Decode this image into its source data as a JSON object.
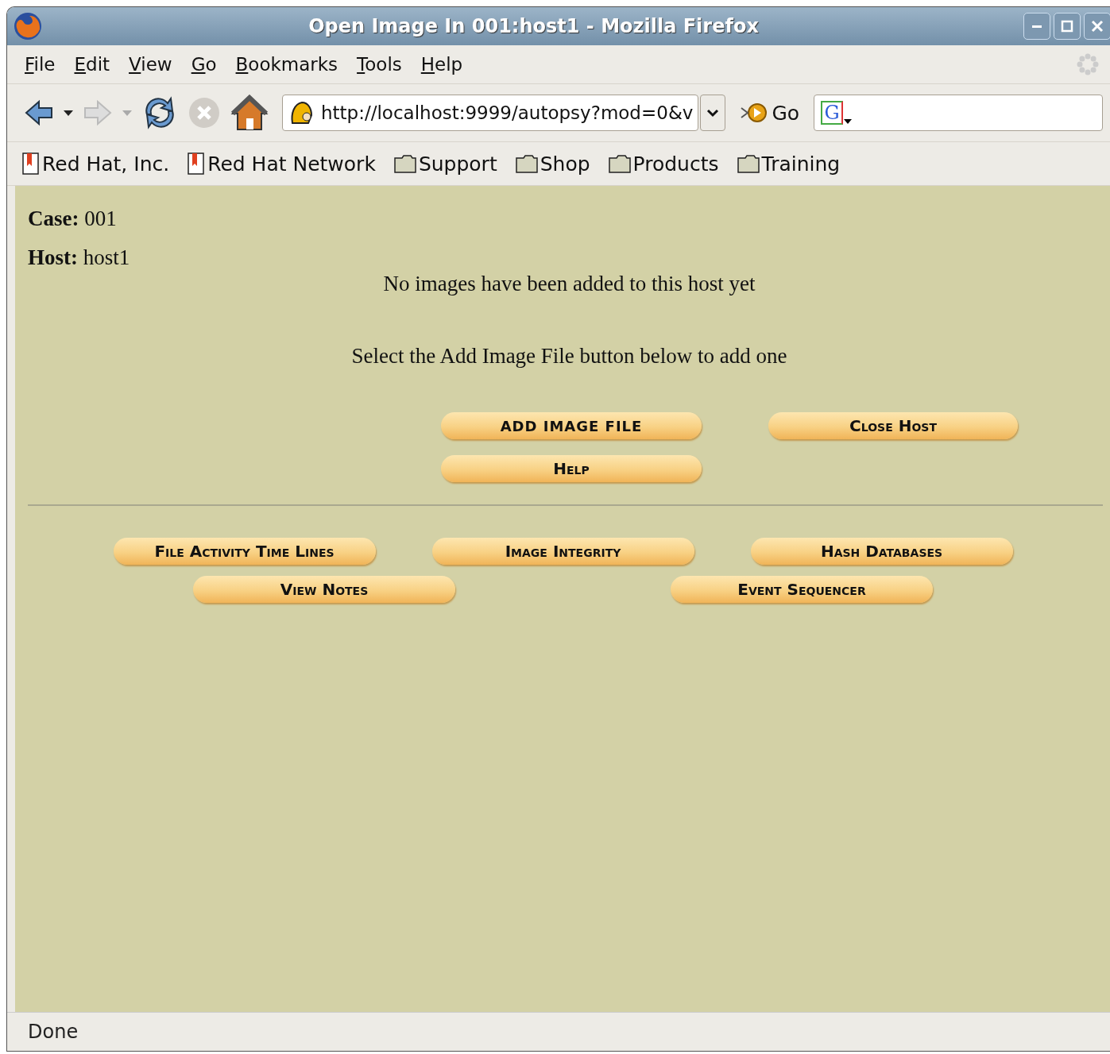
{
  "window": {
    "title": "Open Image In 001:host1 - Mozilla Firefox"
  },
  "menu": [
    "File",
    "Edit",
    "View",
    "Go",
    "Bookmarks",
    "Tools",
    "Help"
  ],
  "nav_buttons": [
    {
      "kind": "back",
      "disabled": false
    },
    {
      "kind": "forward",
      "disabled": true
    },
    {
      "kind": "reload",
      "disabled": false
    },
    {
      "kind": "stop",
      "disabled": true
    },
    {
      "kind": "home",
      "disabled": false
    }
  ],
  "address": {
    "value": "http://localhost:9999/autopsy?mod=0&v"
  },
  "go_button": {
    "label": "Go"
  },
  "search_field": {
    "engine_letter": "G"
  },
  "bookmarks": [
    {
      "label": "Red Hat, Inc.",
      "kind": "bookmark"
    },
    {
      "label": "Red Hat Network",
      "kind": "bookmark"
    },
    {
      "label": "Support",
      "kind": "folder"
    },
    {
      "label": "Shop",
      "kind": "folder"
    },
    {
      "label": "Products",
      "kind": "folder"
    },
    {
      "label": "Training",
      "kind": "folder"
    }
  ],
  "page": {
    "fields": [
      {
        "label": "Case:",
        "value": "001"
      },
      {
        "label": "Host:",
        "value": "host1"
      }
    ],
    "messages": [
      "No images have been added to this host yet",
      "Select the Add Image File button below to add one"
    ],
    "host_buttons": [
      {
        "label": "ADD IMAGE FILE"
      },
      {
        "label": "Close Host"
      },
      {
        "label": "Help"
      }
    ],
    "tool_buttons_row_1": [
      {
        "label": "File Activity Time Lines"
      },
      {
        "label": "Image Integrity"
      },
      {
        "label": "Hash Databases"
      }
    ],
    "tool_buttons_row_2": [
      {
        "label": "View Notes"
      },
      {
        "label": "Event Sequencer"
      }
    ]
  },
  "status_bar": {
    "text": "Done"
  }
}
